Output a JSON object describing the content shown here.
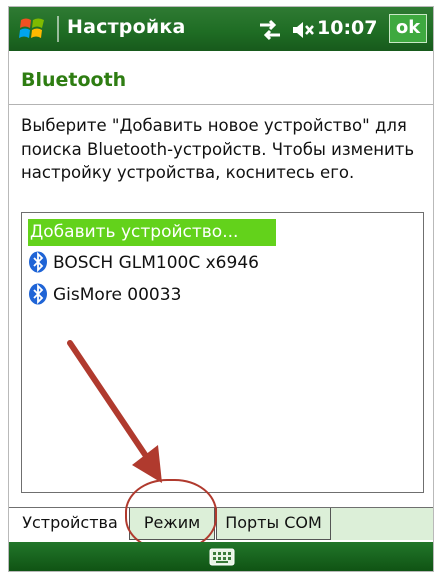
{
  "titlebar": {
    "app_title": "Настройка",
    "clock": "10:07",
    "ok_label": "ok",
    "icons": [
      "windows-start-icon",
      "connectivity-icon",
      "volume-muted-icon"
    ]
  },
  "page": {
    "heading": "Bluetooth",
    "instructions": "Выберите \"Добавить новое устройство\" для поиска Bluetooth-устройств. Чтобы изменить настройку устройства, коснитесь его."
  },
  "device_list": {
    "add_item": "Добавить устройство...",
    "devices": [
      {
        "name": "BOSCH GLM100C x6946",
        "icon": "bluetooth-icon"
      },
      {
        "name": "GisMore 00033",
        "icon": "bluetooth-icon"
      }
    ]
  },
  "tabs": [
    {
      "label": "Устройства",
      "active": true
    },
    {
      "label": "Режим",
      "active": false
    },
    {
      "label": "Порты COM",
      "active": false
    }
  ],
  "bottombar": {
    "icon": "keyboard-icon"
  },
  "colors": {
    "titlebar_green": "#1f6d24",
    "heading_green": "#2e7d12",
    "selection_green": "#63d21b",
    "annotation_red": "#b03a2e",
    "tab_bg": "#dcefd8"
  }
}
